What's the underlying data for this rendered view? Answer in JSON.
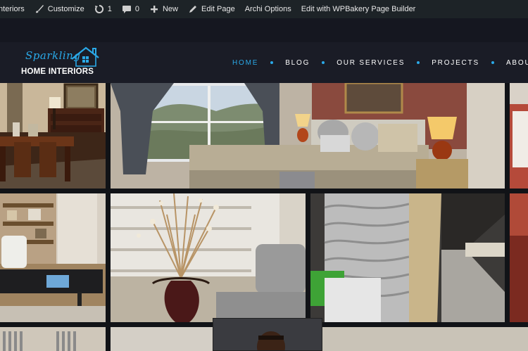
{
  "adminbar": {
    "items": [
      {
        "label": "Interiors",
        "icon": "home-icon"
      },
      {
        "label": "Customize",
        "icon": "paintbrush-icon"
      },
      {
        "label": "1",
        "icon": "updates-icon"
      },
      {
        "label": "0",
        "icon": "comment-icon"
      },
      {
        "label": "New",
        "icon": "plus-icon"
      },
      {
        "label": "Edit Page",
        "icon": "pencil-icon"
      },
      {
        "label": "Archi Options",
        "icon": ""
      },
      {
        "label": "Edit with WPBakery Page Builder",
        "icon": ""
      }
    ]
  },
  "site": {
    "logo_script": "Sparkling",
    "logo_main": "HOME INTERIORS",
    "accent_color": "#2aa9e8"
  },
  "nav": {
    "items": [
      "HOME",
      "BLOG",
      "OUR SERVICES",
      "PROJECTS",
      "ABOUT US"
    ],
    "active": "HOME"
  },
  "gallery": {
    "tiles": [
      {
        "name": "dining-room-photo"
      },
      {
        "name": "bedroom-photo"
      },
      {
        "name": "partial-photo-right-top"
      },
      {
        "name": "office-photo"
      },
      {
        "name": "vase-living-room-photo"
      },
      {
        "name": "wave-wall-hallway-photo"
      },
      {
        "name": "partial-photo-right-bottom"
      }
    ]
  }
}
